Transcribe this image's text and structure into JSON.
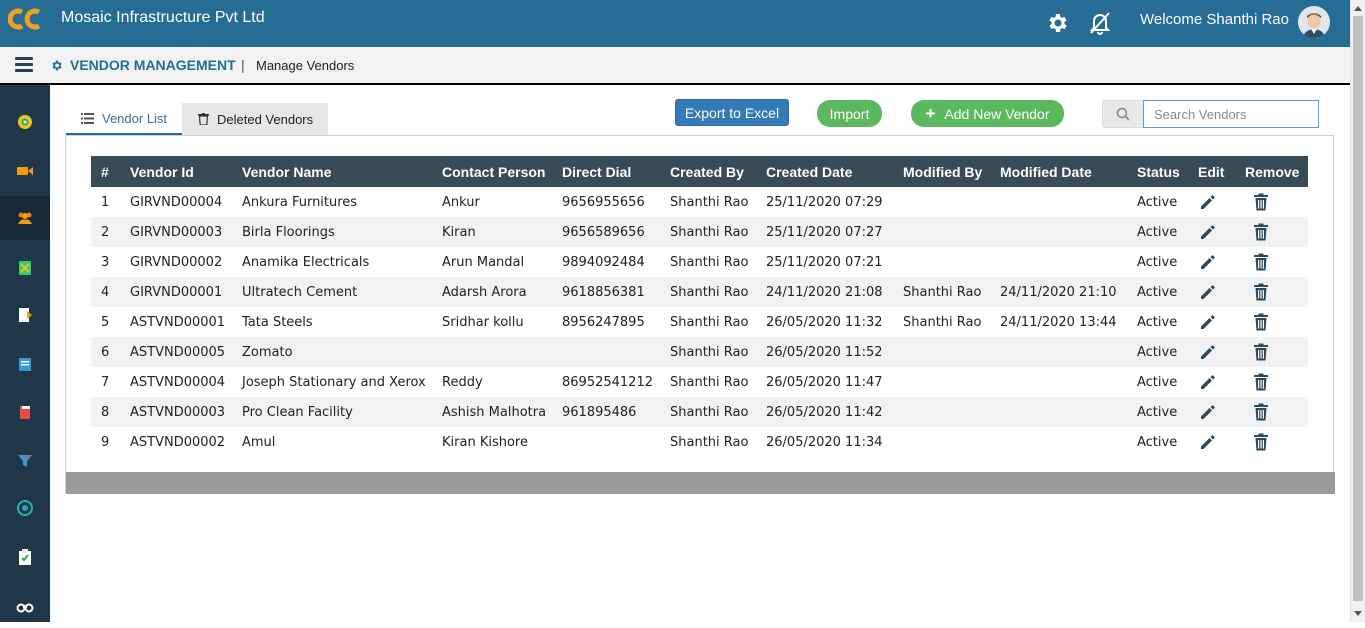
{
  "header": {
    "company": "Mosaic Infrastructure Pvt Ltd",
    "welcome": "Welcome Shanthi Rao",
    "colors": {
      "bar": "#256d94",
      "sidebar": "#203748",
      "accent": "#5cb85c",
      "primary": "#337ab7"
    }
  },
  "subheader": {
    "module": "VENDOR MANAGEMENT",
    "separator": "|",
    "page": "Manage Vendors"
  },
  "sidebar": {
    "icons": [
      "dashboard-icon",
      "video-icon",
      "users-icon",
      "spreadsheet-icon",
      "document-icon",
      "notes-icon",
      "book-icon",
      "filter-icon",
      "target-icon",
      "clipboard-icon",
      "binoculars-icon"
    ]
  },
  "tabs": {
    "list": "Vendor List",
    "deleted": "Deleted Vendors"
  },
  "toolbar": {
    "export": "Export to Excel",
    "import": "Import",
    "add": "Add New Vendor",
    "search_placeholder": "Search Vendors"
  },
  "table": {
    "columns": [
      "#",
      "Vendor Id",
      "Vendor Name",
      "Contact Person",
      "Direct Dial",
      "Created By",
      "Created Date",
      "Modified By",
      "Modified Date",
      "Status",
      "Edit",
      "Remove"
    ],
    "rows": [
      [
        "1",
        "GIRVND00004",
        "Ankura Furnitures",
        "Ankur",
        "9656955656",
        "Shanthi Rao",
        "25/11/2020 07:29",
        "",
        "",
        "Active"
      ],
      [
        "2",
        "GIRVND00003",
        "Birla Floorings",
        "Kiran",
        "9656589656",
        "Shanthi Rao",
        "25/11/2020 07:27",
        "",
        "",
        "Active"
      ],
      [
        "3",
        "GIRVND00002",
        "Anamika Electricals",
        "Arun Mandal",
        "9894092484",
        "Shanthi Rao",
        "25/11/2020 07:21",
        "",
        "",
        "Active"
      ],
      [
        "4",
        "GIRVND00001",
        "Ultratech Cement",
        "Adarsh Arora",
        "9618856381",
        "Shanthi Rao",
        "24/11/2020 21:08",
        "Shanthi Rao",
        "24/11/2020 21:10",
        "Active"
      ],
      [
        "5",
        "ASTVND00001",
        "Tata Steels",
        "Sridhar kollu",
        "8956247895",
        "Shanthi Rao",
        "26/05/2020 11:32",
        "Shanthi Rao",
        "24/11/2020 13:44",
        "Active"
      ],
      [
        "6",
        "ASTVND00005",
        "Zomato",
        "",
        "",
        "Shanthi Rao",
        "26/05/2020 11:52",
        "",
        "",
        "Active"
      ],
      [
        "7",
        "ASTVND00004",
        "Joseph Stationary and Xerox",
        "Reddy",
        "86952541212",
        "Shanthi Rao",
        "26/05/2020 11:47",
        "",
        "",
        "Active"
      ],
      [
        "8",
        "ASTVND00003",
        "Pro Clean Facility",
        "Ashish Malhotra",
        "961895486",
        "Shanthi Rao",
        "26/05/2020 11:42",
        "",
        "",
        "Active"
      ],
      [
        "9",
        "ASTVND00002",
        "Amul",
        "Kiran Kishore",
        "",
        "Shanthi Rao",
        "26/05/2020 11:34",
        "",
        "",
        "Active"
      ]
    ]
  }
}
